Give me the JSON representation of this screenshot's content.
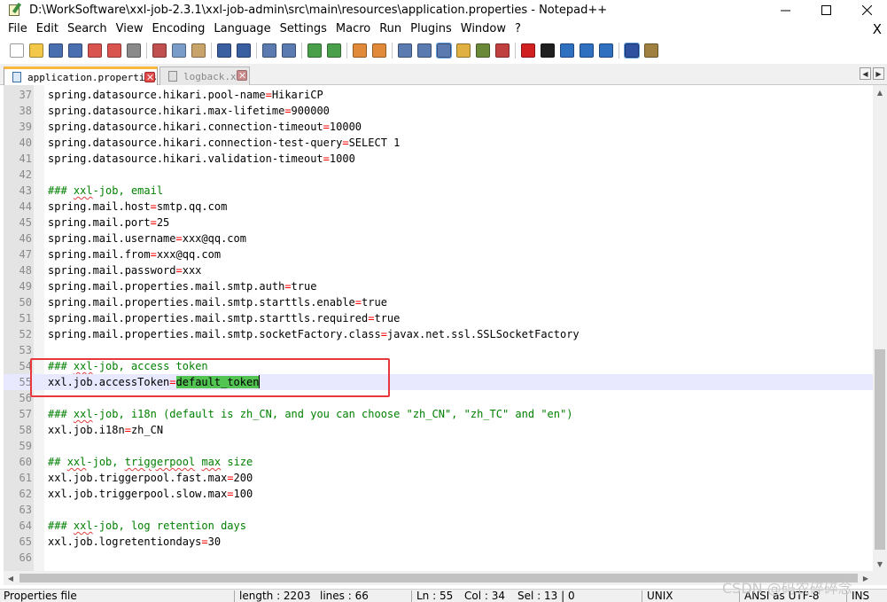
{
  "window": {
    "title": "D:\\WorkSoftware\\xxl-job-2.3.1\\xxl-job-admin\\src\\main\\resources\\application.properties - Notepad++"
  },
  "menu": {
    "items": [
      "File",
      "Edit",
      "Search",
      "View",
      "Encoding",
      "Language",
      "Settings",
      "Macro",
      "Run",
      "Plugins",
      "Window",
      "?"
    ],
    "close_label": "X"
  },
  "toolbar": {
    "buttons": [
      "new-file-icon",
      "open-file-icon",
      "save-icon",
      "save-all-icon",
      "close-icon",
      "close-all-icon",
      "print-icon",
      "cut-icon",
      "copy-icon",
      "paste-icon",
      "undo-icon",
      "redo-icon",
      "find-icon",
      "replace-icon",
      "zoom-in-icon",
      "zoom-out-icon",
      "sync-vertical-icon",
      "sync-horizontal-icon",
      "word-wrap-icon",
      "show-all-characters-icon",
      "indent-guide-icon",
      "document-map-icon",
      "function-list-icon",
      "folder-as-workspace-icon",
      "record-macro-icon",
      "stop-recording-icon",
      "playback-macro-icon",
      "run-macro-multiple-icon",
      "save-macro-icon",
      "spell-check-icon",
      "plugin-icon"
    ]
  },
  "tabs": [
    {
      "label": "application.properties",
      "active": true
    },
    {
      "label": "logback.xml",
      "active": false
    }
  ],
  "editor": {
    "lines": [
      {
        "n": "37",
        "key": "spring.datasource.hikari.pool-name",
        "val": "HikariCP"
      },
      {
        "n": "38",
        "key": "spring.datasource.hikari.max-lifetime",
        "val": "900000"
      },
      {
        "n": "39",
        "key": "spring.datasource.hikari.connection-timeout",
        "val": "10000"
      },
      {
        "n": "40",
        "key": "spring.datasource.hikari.connection-test-query",
        "val": "SELECT 1"
      },
      {
        "n": "41",
        "key": "spring.datasource.hikari.validation-timeout",
        "val": "1000"
      },
      {
        "n": "42"
      },
      {
        "n": "43",
        "comment": "### xxl-job, email"
      },
      {
        "n": "44",
        "key": "spring.mail.host",
        "val": "smtp.qq.com"
      },
      {
        "n": "45",
        "key": "spring.mail.port",
        "val": "25"
      },
      {
        "n": "46",
        "key": "spring.mail.username",
        "val": "xxx@qq.com"
      },
      {
        "n": "47",
        "key": "spring.mail.from",
        "val": "xxx@qq.com"
      },
      {
        "n": "48",
        "key": "spring.mail.password",
        "val": "xxx"
      },
      {
        "n": "49",
        "key": "spring.mail.properties.mail.smtp.auth",
        "val": "true"
      },
      {
        "n": "50",
        "key": "spring.mail.properties.mail.smtp.starttls.enable",
        "val": "true"
      },
      {
        "n": "51",
        "key": "spring.mail.properties.mail.smtp.starttls.required",
        "val": "true"
      },
      {
        "n": "52",
        "key": "spring.mail.properties.mail.smtp.socketFactory.class",
        "val": "javax.net.ssl.SSLSocketFactory"
      },
      {
        "n": "53"
      },
      {
        "n": "54",
        "comment": "### xxl-job, access token"
      },
      {
        "n": "55",
        "key": "xxl.job.accessToken",
        "val": "default_token",
        "selected": true,
        "current": true
      },
      {
        "n": "56"
      },
      {
        "n": "57",
        "comment": "### xxl-job, i18n (default is zh_CN, and you can choose \"zh_CN\", \"zh_TC\" and \"en\")"
      },
      {
        "n": "58",
        "key": "xxl.job.i18n",
        "val": "zh_CN"
      },
      {
        "n": "59"
      },
      {
        "n": "60",
        "comment": "## xxl-job, triggerpool max size"
      },
      {
        "n": "61",
        "key": "xxl.job.triggerpool.fast.max",
        "val": "200"
      },
      {
        "n": "62",
        "key": "xxl.job.triggerpool.slow.max",
        "val": "100"
      },
      {
        "n": "63"
      },
      {
        "n": "64",
        "comment": "### xxl-job, log retention days"
      },
      {
        "n": "65",
        "key": "xxl.job.logretentiondays",
        "val": "30"
      },
      {
        "n": "66"
      }
    ]
  },
  "status": {
    "file_type": "Properties file",
    "length": "length : 2203",
    "lines": "lines : 66",
    "ln": "Ln : 55",
    "col": "Col : 34",
    "sel": "Sel : 13 | 0",
    "eol": "UNIX",
    "encoding": "ANSI as UTF-8",
    "mode": "INS"
  },
  "watermark": "CSDN @码农碎碎念",
  "colors": {
    "title_bar": "#ffffff",
    "tab_accent": "#fab83c",
    "gutter": "#e4e4e4",
    "operator": "#ff0000",
    "comment": "#008000",
    "selection": "#52c452",
    "current_line": "#e8e8ff",
    "annotation_box": "#e8383d"
  }
}
